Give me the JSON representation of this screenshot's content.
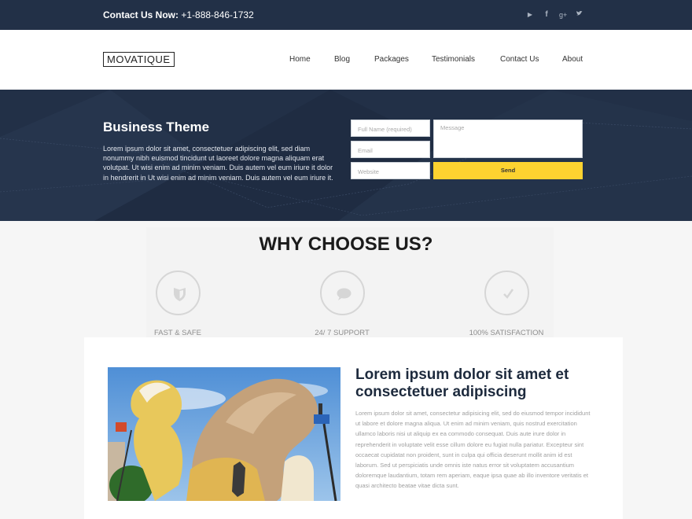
{
  "topbar": {
    "contact_label": "Contact Us Now:",
    "contact_phone": "+1-888-846-1732",
    "social": [
      {
        "icon": "youtube-icon",
        "glyph": "▶"
      },
      {
        "icon": "facebook-icon",
        "glyph": "f"
      },
      {
        "icon": "google-plus-icon",
        "glyph": "g+"
      },
      {
        "icon": "twitter-icon",
        "glyph": "🐦"
      }
    ]
  },
  "header": {
    "logo": "MOVATIQUE",
    "nav": [
      "Home",
      "Blog",
      "Packages",
      "Testimonials",
      "Contact Us",
      "About"
    ]
  },
  "hero": {
    "title": "Business Theme",
    "text": "Lorem ipsum dolor sit amet, consectetuer adipiscing elit, sed diam nonummy nibh euismod tincidunt ut laoreet dolore magna aliquam erat volutpat. Ut wisi enim ad minim veniam. Duis autem vel eum iriure it dolor in hendrerit in Ut wisi enim ad minim veniam. Duis autem vel eum iriure it.",
    "form": {
      "name_placeholder": "Full Name (required)",
      "email_placeholder": "Email",
      "website_placeholder": "Website",
      "message_placeholder": "Message",
      "send_label": "Send"
    }
  },
  "why": {
    "title": "WHY CHOOSE US?",
    "features": [
      {
        "label": "FAST & SAFE",
        "icon": "shield-icon"
      },
      {
        "label": "24/ 7 SUPPORT",
        "icon": "chat-bubble-icon"
      },
      {
        "label": "100% SATISFACTION",
        "icon": "checkmark-icon"
      }
    ]
  },
  "content": {
    "heading": "Lorem ipsum dolor sit amet et consectetuer adipiscing",
    "body": "Lorem ipsum dolor sit amet, consectetur adipisicing elit, sed do eiusmod tempor incididunt ut labore et dolore magna aliqua. Ut enim ad minim veniam, quis nostrud exercitation ullamco laboris nisi ut aliquip ex ea commodo consequat. Duis aute irure dolor in reprehenderit in voluptate velit esse cillum dolore eu fugiat nulla pariatur. Excepteur sint occaecat cupidatat non proident, sunt in culpa qui officia deserunt mollit anim id est laborum. Sed ut perspiciatis unde omnis iste natus error sit voluptatem accusantium doloremque laudantium, totam rem aperiam, eaque ipsa quae ab illo inventore veritatis et quasi architecto beatae vitae dicta sunt."
  },
  "colors": {
    "dark_navy": "#223047",
    "accent_yellow": "#fdd330"
  }
}
